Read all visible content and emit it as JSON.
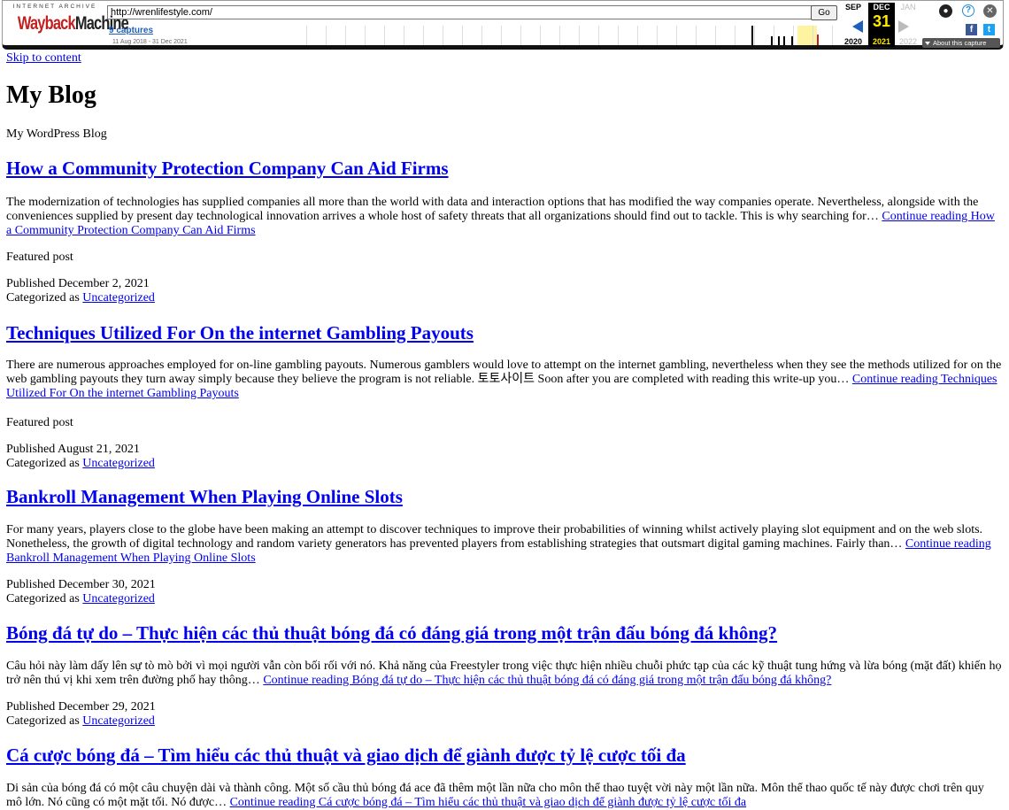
{
  "wayback": {
    "logo_top": "INTERNET ARCHIVE",
    "logo_wayback": "Wayback",
    "logo_machine": "Machine",
    "url": "http://wrenlifestyle.com/",
    "go_label": "Go",
    "captures_label": "9 captures",
    "date_range": "11 Aug 2018 - 31 Dec 2021",
    "prev_month": "SEP",
    "prev_year": "2020",
    "current_month": "DEC",
    "current_day": "31",
    "current_year": "2021",
    "next_month": "JAN",
    "next_year": "2022",
    "about_label": "About this capture",
    "highlight_color": "#fdf3a0",
    "current_text_color": "#ffea00"
  },
  "site": {
    "skip_link": "Skip to content",
    "title": "My Blog",
    "description": "My WordPress Blog"
  },
  "posts": [
    {
      "title": "How a Community Protection Company Can Aid Firms",
      "excerpt": "The modernization of technologies has supplied companies all more than the world with data and interaction options that has modified the way companies operate. Nevertheless, alongside with the conveniences supplied by present day technological innovation arrives a whole host of safety threats that all organizations should find out to tackle. This is why searching for…",
      "continue_link": "Continue reading How a Community Protection Company Can Aid Firms",
      "featured": "Featured post",
      "published": "Published December 2, 2021",
      "categorized_prefix": "Categorized as",
      "category": "Uncategorized"
    },
    {
      "title": "Techniques Utilized For On the internet Gambling Payouts",
      "excerpt": "There are numerous approaches employed for on-line gambling payouts. Numerous gamblers would love to attempt on the internet gambling, nevertheless when they see the methods utilized for on the web gambling payouts they turn away simply because they believe the program is not reliable. 토토사이트 Soon after you are completed with reading this write-up you…",
      "continue_link": "Continue reading Techniques Utilized For On the internet Gambling Payouts",
      "featured": "Featured post",
      "published": "Published August 21, 2021",
      "categorized_prefix": "Categorized as",
      "category": "Uncategorized"
    },
    {
      "title": "Bankroll Management When Playing Online Slots",
      "excerpt": "For many years, players close to the globe have been making an attempt to discover techniques to improve their probabilities of winning whilst actively playing slot equipment and on the web slots. Nonetheless, the growth of digital technology and random variety generators has prevented players from establishing strategies that outsmart digital gaming machines. Fairly than…",
      "continue_link": "Continue reading Bankroll Management When Playing Online Slots",
      "published": "Published December 30, 2021",
      "categorized_prefix": "Categorized as",
      "category": "Uncategorized"
    },
    {
      "title": "Bóng đá tự do – Thực hiện các thủ thuật bóng đá có đáng giá trong một trận đấu bóng đá không?",
      "excerpt": "Câu hỏi này làm dấy lên sự tò mò bởi vì mọi người vẫn còn bối rối với nó. Khả năng của Freestyler trong việc thực hiện nhiều chuỗi phức tạp của các kỹ thuật tung hứng và lừa bóng (mặt đất) khiến họ trở nên thú vị khi xem trên đường phố hay thông…",
      "continue_link": "Continue reading Bóng đá tự do – Thực hiện các thủ thuật bóng đá có đáng giá trong một trận đấu bóng đá không?",
      "published": "Published December 29, 2021",
      "categorized_prefix": "Categorized as",
      "category": "Uncategorized"
    },
    {
      "title": "Cá cược bóng đá – Tìm hiểu các thủ thuật và giao dịch để giành được tỷ lệ cược tối đa",
      "excerpt": "Di sản của bóng đá có một câu chuyện dài và thành công. Một số cầu thủ bóng đá ace đã thêm một lần nữa cho môn thể thao tuyệt vời này một lần nữa. Môn thể thao quốc tế này được chơi trên quy mô lớn. Nó cũng có một mặt tối. Nó được…",
      "continue_link": "Continue reading Cá cược bóng đá – Tìm hiểu các thủ thuật và giao dịch để giành được tỷ lệ cược tối đa"
    }
  ]
}
